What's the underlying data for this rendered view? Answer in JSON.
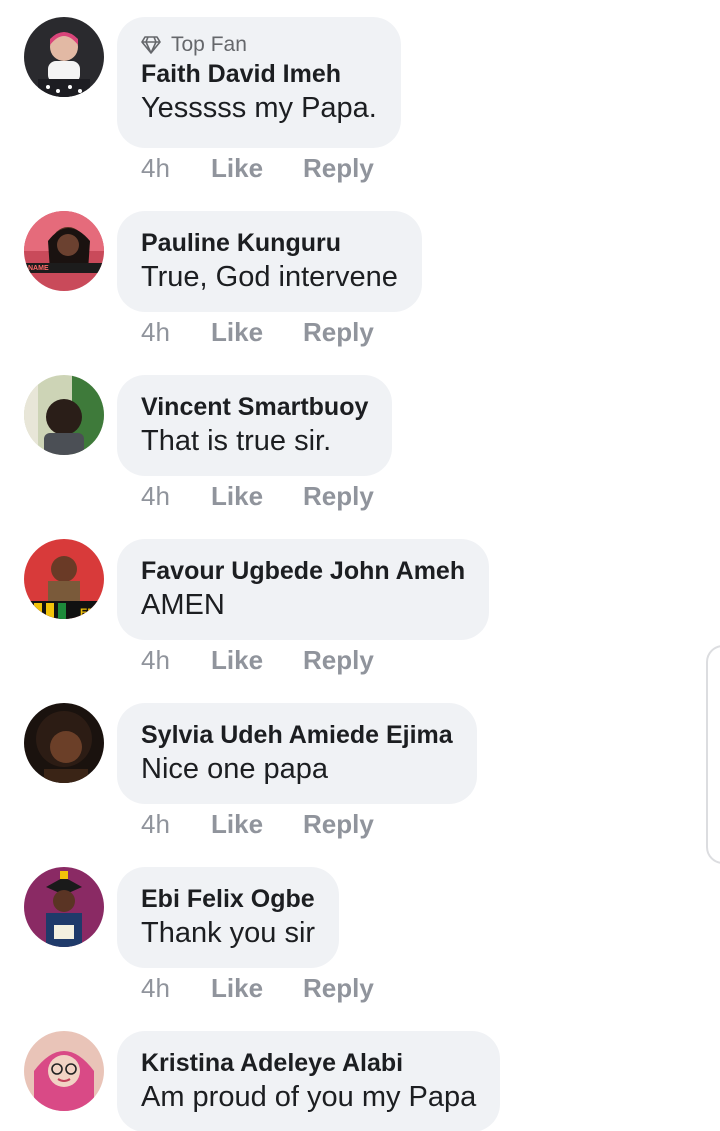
{
  "comments": [
    {
      "badge": "Top Fan",
      "author": "Faith David Imeh",
      "text": "Yesssss my Papa.",
      "time": "4h",
      "like": "Like",
      "reply": "Reply"
    },
    {
      "author": "Pauline Kunguru",
      "text": "True, God intervene",
      "time": "4h",
      "like": "Like",
      "reply": "Reply"
    },
    {
      "author": "Vincent Smartbuoy",
      "text": "That is true sir.",
      "time": "4h",
      "like": "Like",
      "reply": "Reply"
    },
    {
      "author": "Favour Ugbede John Ameh",
      "text": "AMEN",
      "time": "4h",
      "like": "Like",
      "reply": "Reply"
    },
    {
      "author": "Sylvia Udeh Amiede Ejima",
      "text": "Nice one papa",
      "time": "4h",
      "like": "Like",
      "reply": "Reply"
    },
    {
      "author": "Ebi Felix Ogbe",
      "text": "Thank you sir",
      "time": "4h",
      "like": "Like",
      "reply": "Reply"
    },
    {
      "author": "Kristina Adeleye Alabi",
      "text": "Am proud of you my Papa"
    }
  ]
}
